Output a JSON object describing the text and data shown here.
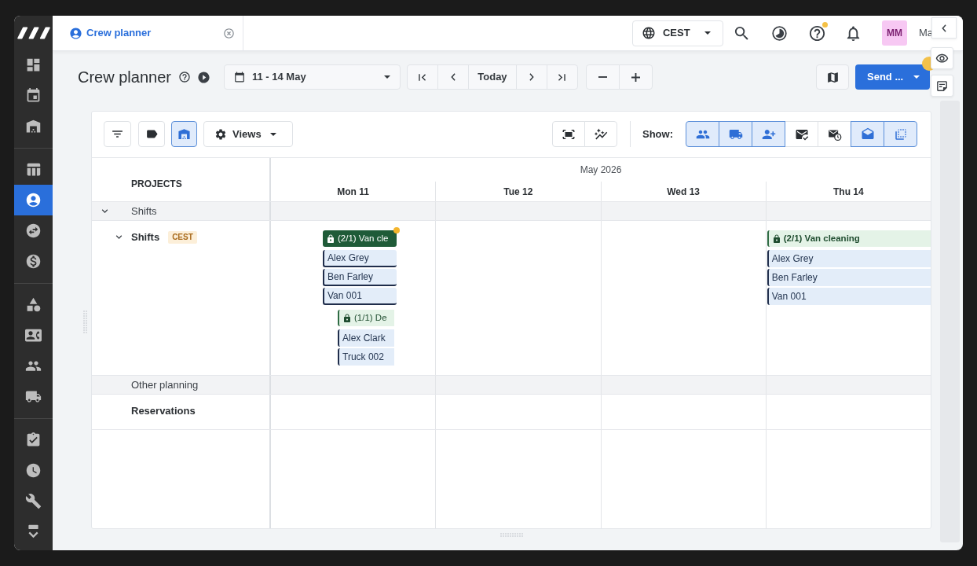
{
  "sidebar": {
    "groups": [
      {
        "items": [
          {
            "selected": false
          },
          {
            "selected": false
          },
          {
            "selected": false
          }
        ]
      },
      {
        "items": [
          {
            "selected": false
          },
          {
            "selected": true
          },
          {
            "selected": false
          },
          {
            "selected": false
          }
        ]
      },
      {
        "items": [
          {
            "selected": false
          },
          {
            "selected": false
          },
          {
            "selected": false
          },
          {
            "selected": false
          }
        ]
      },
      {
        "items": [
          {
            "selected": false
          },
          {
            "selected": false
          },
          {
            "selected": false
          },
          {
            "selected": false
          }
        ]
      }
    ]
  },
  "top_bar": {
    "tabs": [
      {
        "label": "Crew planner",
        "selected": true
      }
    ],
    "timezone": "CEST",
    "help_notification": true,
    "avatar_initials": "MM",
    "user_name": "Ma"
  },
  "header": {
    "title": "Crew planner",
    "date_range": "11 - 14 May",
    "today": "Today",
    "send": {
      "label": "Send ...",
      "notification": true
    }
  },
  "toolbar": {
    "tools": [
      {
        "selected": false
      },
      {
        "selected": false
      },
      {
        "selected": true
      }
    ],
    "views": "Views",
    "show_label": "Show:",
    "show_toggles": [
      {
        "selected": true
      },
      {
        "selected": true
      },
      {
        "selected": true
      },
      {
        "selected": false
      },
      {
        "selected": false
      },
      {
        "selected": true
      },
      {
        "selected": true
      }
    ]
  },
  "planner": {
    "projects_heading": "PROJECTS",
    "month": "May 2026",
    "days": [
      "Mon 11",
      "Tue 12",
      "Wed 13",
      "Thu 14"
    ],
    "rows": [
      {
        "kind": "group",
        "label": "Shifts",
        "expanded": true,
        "children": [
          {
            "kind": "project",
            "label": "Shifts",
            "badge": "CEST",
            "expanded": true,
            "cells": [
              {
                "bookings": [
                  {
                    "kind": "compact",
                    "title": "(2/1) Van cle",
                    "selected": true,
                    "locked": true,
                    "notification": true,
                    "resources": [
                      "Alex Grey",
                      "Ben Farley",
                      "Van 001"
                    ]
                  },
                  {
                    "kind": "compact",
                    "title": "(1/1) De",
                    "selected": false,
                    "locked": true,
                    "notification": false,
                    "resources": [
                      "Alex Clark",
                      "Truck 002"
                    ]
                  }
                ]
              },
              {},
              {},
              {
                "bookings": [
                  {
                    "kind": "wide",
                    "title": "(2/1) Van cleaning",
                    "selected": false,
                    "locked": true,
                    "notification": false,
                    "resources": [
                      "Alex Grey",
                      "Ben Farley",
                      "Van 001"
                    ]
                  }
                ]
              }
            ]
          }
        ]
      },
      {
        "kind": "group",
        "label": "Other planning"
      },
      {
        "kind": "project",
        "label": "Reservations"
      }
    ]
  }
}
